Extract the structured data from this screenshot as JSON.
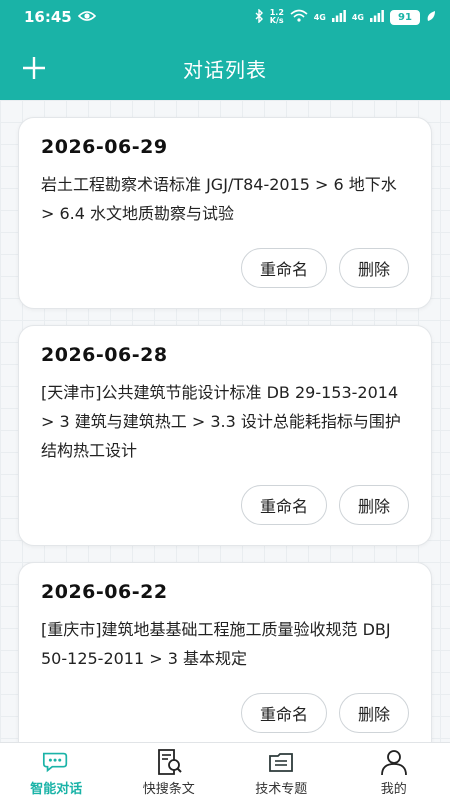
{
  "status": {
    "time": "16:45",
    "speed": "1.2 K/s",
    "network1": "4G",
    "network2": "4G",
    "battery": "91"
  },
  "header": {
    "title": "对话列表"
  },
  "conversations": [
    {
      "date": "2026-06-29",
      "text": "岩土工程勘察术语标准 JGJ/T84-2015 > 6 地下水 > 6.4 水文地质勘察与试验",
      "rename": "重命名",
      "delete": "删除"
    },
    {
      "date": "2026-06-28",
      "text": "[天津市]公共建筑节能设计标准 DB 29-153-2014 > 3 建筑与建筑热工 > 3.3 设计总能耗指标与围护结构热工设计",
      "rename": "重命名",
      "delete": "删除"
    },
    {
      "date": "2026-06-22",
      "text": "[重庆市]建筑地基基础工程施工质量验收规范 DBJ 50-125-2011 > 3 基本规定",
      "rename": "重命名",
      "delete": "删除"
    }
  ],
  "tabs": [
    {
      "label": "智能对话",
      "icon": "chat-bubble-icon",
      "active": true
    },
    {
      "label": "快搜条文",
      "icon": "document-search-icon",
      "active": false
    },
    {
      "label": "技术专题",
      "icon": "layers-folder-icon",
      "active": false
    },
    {
      "label": "我的",
      "icon": "user-icon",
      "active": false
    }
  ],
  "colors": {
    "accent": "#1ab3a7"
  }
}
